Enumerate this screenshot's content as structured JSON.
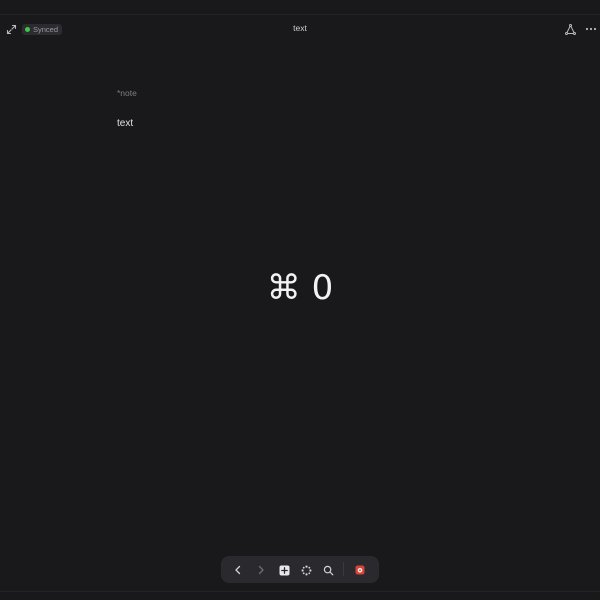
{
  "header": {
    "sync_status": "Synced",
    "title": "text"
  },
  "note": {
    "tag": "*note",
    "body": "text"
  },
  "overlay": {
    "shortcut": "⌘ 0"
  },
  "toolbar": {
    "items": [
      "back",
      "forward",
      "new-note",
      "command-palette",
      "search",
      "app"
    ]
  },
  "colors": {
    "background": "#19181b",
    "synced_dot": "#3ec74a",
    "toolbar_bg": "#2a292e",
    "app_icon": "#d9443a"
  }
}
